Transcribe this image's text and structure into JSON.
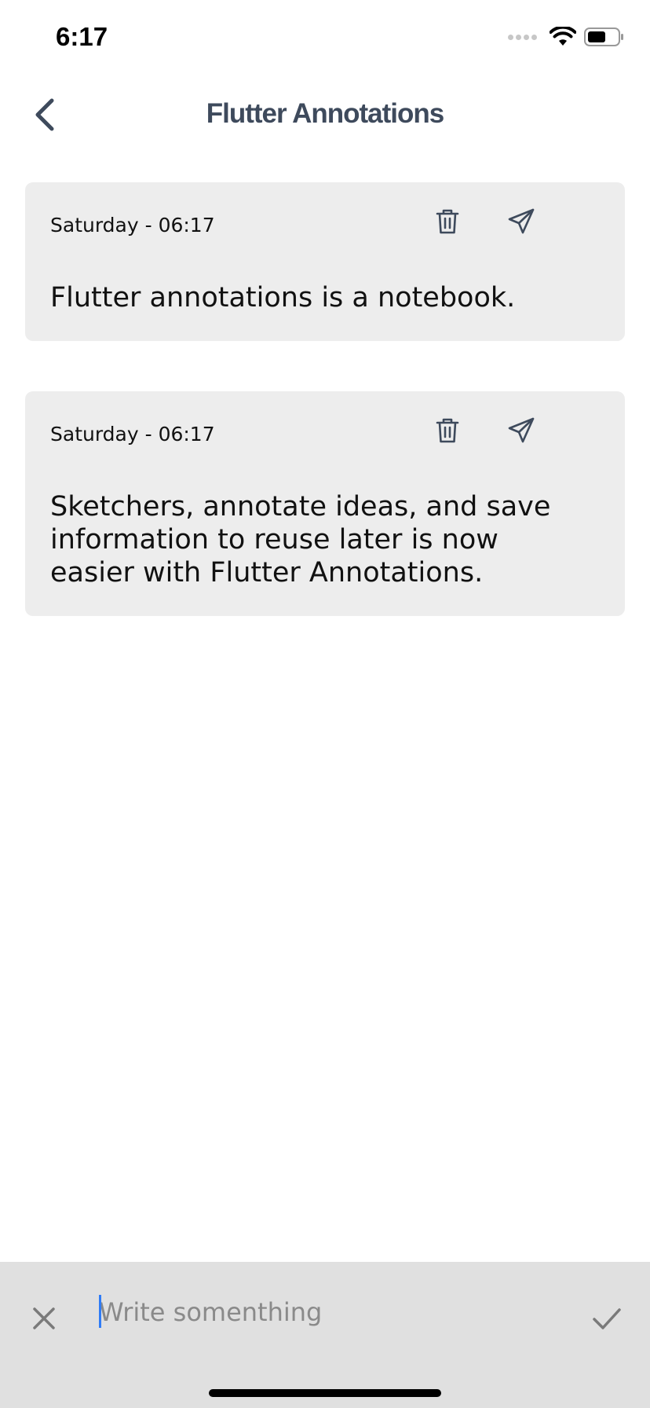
{
  "status_bar": {
    "time": "6:17",
    "icons": [
      "signal-icon",
      "wifi-icon",
      "battery-icon"
    ]
  },
  "app_bar": {
    "title": "Flutter Annotations",
    "back_icon": "chevron-left-icon",
    "accent": "#3e4a5c"
  },
  "notes": [
    {
      "date": "Saturday - 06:17",
      "text": "Flutter annotations is a notebook.",
      "actions": [
        "trash-icon",
        "send-icon"
      ]
    },
    {
      "date": "Saturday - 06:17",
      "text": "Sketchers, annotate ideas, and save information to reuse later is now easier with Flutter Annotations.",
      "actions": [
        "trash-icon",
        "send-icon"
      ]
    }
  ],
  "composer": {
    "placeholder": "Write somenthing",
    "value": "",
    "cancel_icon": "close-icon",
    "confirm_icon": "check-icon",
    "background": "#e0e0e0",
    "caret_color": "#2f7cf6"
  }
}
